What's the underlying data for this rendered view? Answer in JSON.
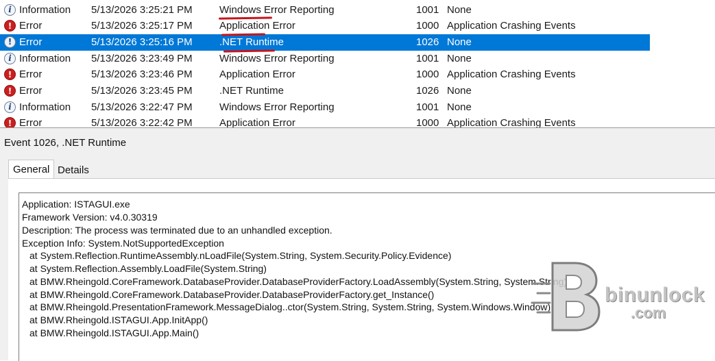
{
  "events": [
    {
      "icon": "information-icon",
      "level": "Information",
      "date": "5/13/2026 3:25:21 PM",
      "source": "Windows Error Reporting",
      "event_id": "1001",
      "task": "None"
    },
    {
      "icon": "error-icon",
      "level": "Error",
      "date": "5/13/2026 3:25:17 PM",
      "source": "Application Error",
      "event_id": "1000",
      "task": "Application Crashing Events"
    },
    {
      "icon": "error-icon",
      "level": "Error",
      "date": "5/13/2026 3:25:16 PM",
      "source": ".NET Runtime",
      "event_id": "1026",
      "task": "None",
      "selected": true
    },
    {
      "icon": "information-icon",
      "level": "Information",
      "date": "5/13/2026 3:23:49 PM",
      "source": "Windows Error Reporting",
      "event_id": "1001",
      "task": "None"
    },
    {
      "icon": "error-icon",
      "level": "Error",
      "date": "5/13/2026 3:23:46 PM",
      "source": "Application Error",
      "event_id": "1000",
      "task": "Application Crashing Events"
    },
    {
      "icon": "error-icon",
      "level": "Error",
      "date": "5/13/2026 3:23:45 PM",
      "source": ".NET Runtime",
      "event_id": "1026",
      "task": "None"
    },
    {
      "icon": "information-icon",
      "level": "Information",
      "date": "5/13/2026 3:22:47 PM",
      "source": "Windows Error Reporting",
      "event_id": "1001",
      "task": "None"
    },
    {
      "icon": "error-icon",
      "level": "Error",
      "date": "5/13/2026 3:22:42 PM",
      "source": "Application Error",
      "event_id": "1000",
      "task": "Application Crashing Events"
    }
  ],
  "details": {
    "title": "Event 1026, .NET Runtime",
    "tabs": {
      "general": "General",
      "details": "Details"
    },
    "description_lines": [
      "Application: ISTAGUI.exe",
      "Framework Version: v4.0.30319",
      "Description: The process was terminated due to an unhandled exception.",
      "Exception Info: System.NotSupportedException",
      "at System.Reflection.RuntimeAssembly.nLoadFile(System.String, System.Security.Policy.Evidence)",
      "at System.Reflection.Assembly.LoadFile(System.String)",
      "at BMW.Rheingold.CoreFramework.DatabaseProvider.DatabaseProviderFactory.LoadAssembly(System.String, System.String)",
      "at BMW.Rheingold.CoreFramework.DatabaseProvider.DatabaseProviderFactory.get_Instance()",
      "at BMW.Rheingold.PresentationFramework.MessageDialog..ctor(System.String, System.String, System.Windows.Window)",
      "at BMW.Rheingold.ISTAGUI.App.InitApp()",
      "at BMW.Rheingold.ISTAGUI.App.Main()"
    ]
  },
  "watermark": {
    "name": "binunlock",
    "domain": ".com"
  },
  "colors": {
    "selection": "#0078d7",
    "annotation": "#c8141c",
    "error": "#cc1f1f"
  }
}
